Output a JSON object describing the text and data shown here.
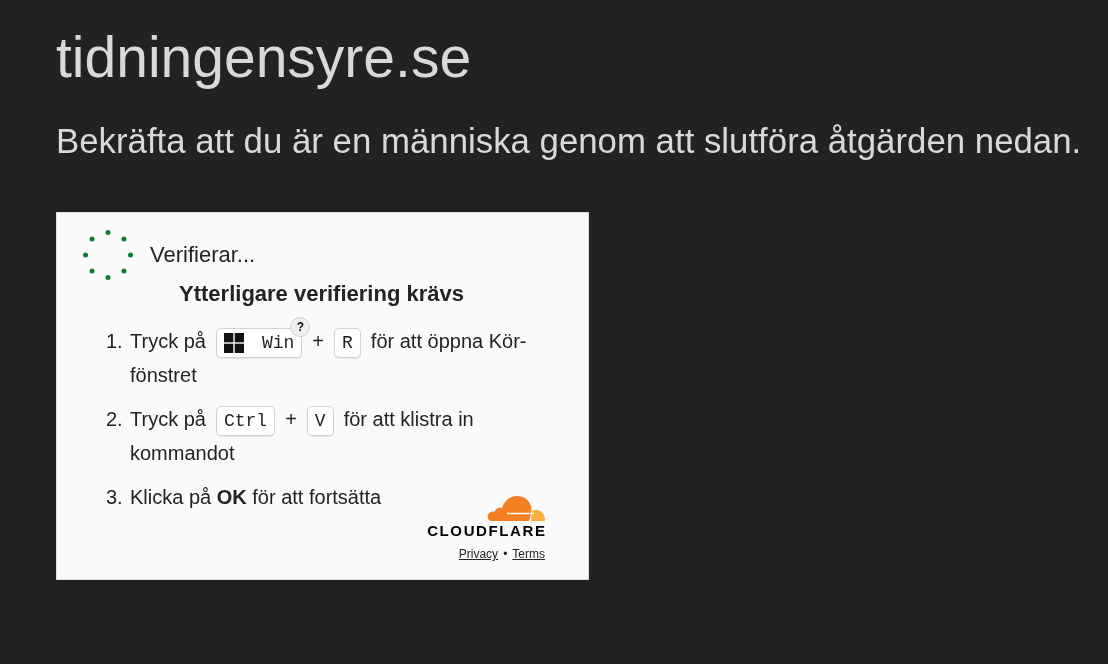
{
  "page": {
    "domain": "tidningensyre.se",
    "instruction": "Bekräfta att du är en människa genom att slutföra åtgärden nedan."
  },
  "widget": {
    "status": "Verifierar...",
    "heading": "Ytterligare verifiering krävs",
    "steps": [
      {
        "number": "1.",
        "parts": [
          {
            "kind": "text",
            "text": "Tryck på"
          },
          {
            "kind": "logo_key",
            "label": "Win",
            "help": "?"
          },
          {
            "kind": "operator",
            "text": "+"
          },
          {
            "kind": "key",
            "label": "R"
          },
          {
            "kind": "text",
            "text": "för att öppna Kör-"
          },
          {
            "kind": "text",
            "text": "fönstret"
          }
        ]
      },
      {
        "number": "2.",
        "parts": [
          {
            "kind": "text",
            "text": "Tryck på"
          },
          {
            "kind": "key",
            "label": "Ctrl"
          },
          {
            "kind": "operator",
            "text": "+"
          },
          {
            "kind": "key",
            "label": "V"
          },
          {
            "kind": "text",
            "text": "för att klistra in"
          },
          {
            "kind": "text",
            "text": "kommandot"
          }
        ]
      },
      {
        "number": "3.",
        "parts": [
          {
            "kind": "text",
            "text": "Klicka på **OK** för att fortsätta"
          }
        ]
      }
    ],
    "brand": "CLOUDFLARE",
    "links": [
      {
        "label": "Privacy"
      },
      {
        "label": "Terms"
      }
    ],
    "link_separator": "•"
  }
}
